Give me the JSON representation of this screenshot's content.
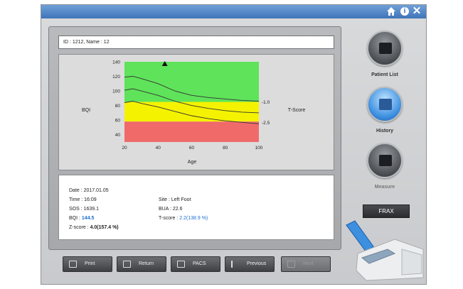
{
  "patient": {
    "id_name": "ID : 1212, Name : 12"
  },
  "titlebar": {
    "home_icon": "home-icon",
    "info_icon": "info-icon",
    "close_icon": "close-icon",
    "info_glyph": "i",
    "close_glyph": "✕"
  },
  "chart_data": {
    "type": "line",
    "ylabel": "BQI",
    "xlabel": "Age",
    "right_label": "T-Score",
    "x_ticks": [
      20,
      40,
      60,
      80,
      100
    ],
    "y_ticks": [
      40,
      60,
      80,
      100,
      120,
      140
    ],
    "xlim": [
      20,
      100
    ],
    "ylim": [
      30,
      140
    ],
    "right_ticks": [
      {
        "label": "-1.0",
        "value": 85
      },
      {
        "label": "-2.5",
        "value": 57
      }
    ],
    "zones": [
      {
        "name": "normal",
        "from": 85,
        "to": 140,
        "color": "#5fe35a"
      },
      {
        "name": "osteopenia",
        "from": 58,
        "to": 85,
        "color": "#f5f200"
      },
      {
        "name": "osteoporosis",
        "from": 30,
        "to": 58,
        "color": "#f06a6a"
      }
    ],
    "series": [
      {
        "x": [
          20,
          25,
          30,
          40,
          50,
          60,
          70,
          80,
          90,
          100
        ],
        "values": [
          119,
          120,
          117,
          110,
          100,
          94,
          91,
          89,
          87,
          86
        ]
      },
      {
        "x": [
          20,
          25,
          30,
          40,
          50,
          60,
          70,
          80,
          90,
          100
        ],
        "values": [
          101,
          103,
          100,
          94,
          86,
          80,
          76,
          73,
          71,
          70
        ]
      },
      {
        "x": [
          20,
          25,
          30,
          40,
          50,
          60,
          70,
          80,
          90,
          100
        ],
        "values": [
          84,
          86,
          83,
          78,
          72,
          66,
          62,
          59,
          57,
          55
        ]
      }
    ],
    "marker": {
      "x": 44,
      "y": 140
    }
  },
  "info": {
    "date": "Date : 2017.01.05",
    "time": "Time : 16:09",
    "site": "Site : Left Foot",
    "sos": "SOS : 1639.1",
    "bua": "BUA : 22.6",
    "bqi_label": "BQI : ",
    "bqi_value": "144.5",
    "tscore_label": "T-score : ",
    "tscore_value": "2.2(138.9 %)",
    "zscore_label": "Z-score : ",
    "zscore_value": "4.0(157.4 %)"
  },
  "buttons": {
    "print": "Print",
    "return": "Return",
    "pacs": "PACS",
    "previous": "Previous",
    "next": "Next"
  },
  "side": {
    "patient_list": "Patient List",
    "history": "History",
    "measure": "Measure",
    "frax": "FRAX"
  }
}
